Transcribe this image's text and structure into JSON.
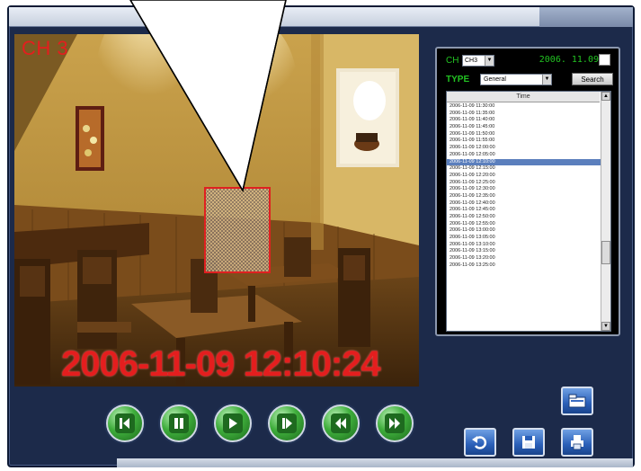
{
  "video": {
    "channel_label": "CH 3",
    "timestamp": "2006-11-09 12:10:24"
  },
  "search_panel": {
    "ch_label": "CH",
    "channel_select": "CH3",
    "date_display": "2006. 11.09",
    "type_label": "TYPE",
    "type_select": "General",
    "search_button": "Search",
    "list_header": "Time",
    "items": [
      "2006-11-09 11:30:00",
      "2006-11-09 11:35:00",
      "2006-11-09 11:40:00",
      "2006-11-09 11:45:00",
      "2006-11-09 11:50:00",
      "2006-11-09 11:55:00",
      "2006-11-09 12:00:00",
      "2006-11-09 12:05:00",
      "2006-11-09 12:10:00",
      "2006-11-09 12:15:00",
      "2006-11-09 12:20:00",
      "2006-11-09 12:25:00",
      "2006-11-09 12:30:00",
      "2006-11-09 12:35:00",
      "2006-11-09 12:40:00",
      "2006-11-09 12:45:00",
      "2006-11-09 12:50:00",
      "2006-11-09 12:55:00",
      "2006-11-09 13:00:00",
      "2006-11-09 13:05:00",
      "2006-11-09 13:10:00",
      "2006-11-09 13:15:00",
      "2006-11-09 13:20:00",
      "2006-11-09 13:25:00"
    ],
    "selected_item": "2006-11-09 12:10:00"
  },
  "controls": {
    "buttons": [
      "step-back",
      "pause",
      "play",
      "step-forward",
      "rewind",
      "fast-forward"
    ]
  },
  "actions": {
    "buttons": [
      "open-folder",
      "undo",
      "save",
      "print"
    ]
  },
  "colors": {
    "overlay_text": "#e41e1e",
    "panel_green": "#22c322",
    "frame_navy": "#1c2a4a",
    "list_selection": "#5b7fbd"
  }
}
